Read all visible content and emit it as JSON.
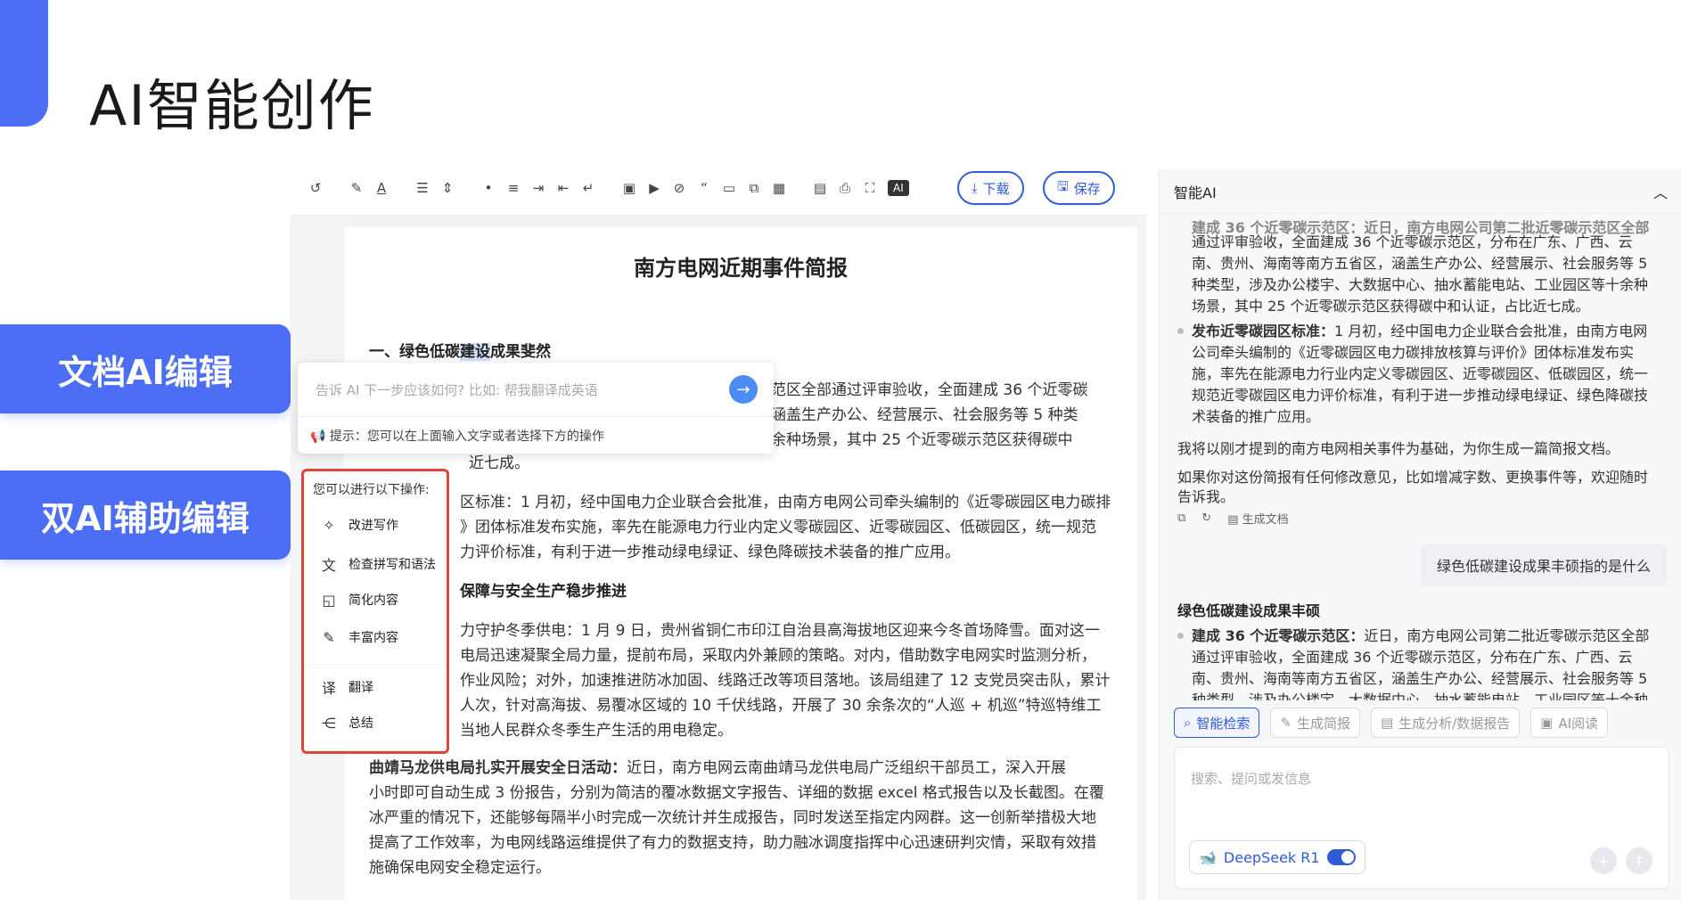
{
  "slide": {
    "title": "AI智能创作",
    "side_buttons": [
      "文档AI编辑",
      "双AI辅助编辑"
    ]
  },
  "toolbar": {
    "ai_label": "AI",
    "download_label": "下载",
    "save_label": "保存"
  },
  "document": {
    "title": "南方电网近期事件简报",
    "section1_heading_a": "一、绿色低碳",
    "section1_heading_sel": "建设",
    "section1_heading_b": "成果斐然",
    "lines_right": [
      "示范区全部通过评审验收，全面建成 36 个近零碳",
      "，涵盖生产办公、经营展示、社会服务等 5 种类",
      "十余种场景，其中 25 个近零碳示范区获得碳中",
      "近七成。"
    ],
    "para2": [
      "区标准：1 月初，经中国电力企业联合会批准，由南方电网公司牵头编制的《近零碳园区电力碳排",
      "》团体标准发布实施，率先在能源电力行业内定义零碳园区、近零碳园区、低碳园区，统一规范",
      "力评价标准，有利于进一步推动绿电绿证、绿色降碳技术装备的推广应用。"
    ],
    "section2_heading": "保障与安全生产稳步推进",
    "para3": [
      "力守护冬季供电：1 月 9 日，贵州省铜仁市印江自治县高海拔地区迎来今冬首场降雪。面对这一",
      "电局迅速凝聚全局力量，提前布局，采取内外兼顾的策略。对内，借助数字电网实时监测分析，",
      "作业风险；对外，加速推进防冰加固、线路迁改等项目落地。该局组建了 12 支党员突击队，累计",
      "人次，针对高海拔、易覆冰区域的 10 千伏线路，开展了 30 余条次的“人巡 + 机巡”特巡特维工",
      "当地人民群众冬季生产生活的用电稳定。"
    ],
    "para4_bold": "曲靖马龙供电局扎实开展安全日活动：",
    "para4_first": "近日，南方电网云南曲靖马龙供电局广泛组织干部员工，深入开展",
    "para4": [
      "小时即可自动生成 3 份报告，分别为简洁的覆冰数据文字报告、详细的数据 excel 格式报告以及长截图。在覆",
      "冰严重的情况下，还能够每隔半小时完成一次统计并生成报告，同时发送至指定内网群。这一创新举措极大地",
      "提高了工作效率，为电网线路运维提供了有力的数据支持，助力融冰调度指挥中心迅速研判灾情，采取有效措",
      "施确保电网安全稳定运行。"
    ]
  },
  "ai_prompt": {
    "placeholder": "告诉 AI 下一步应该如何? 比如: 帮我翻译成英语",
    "hint": "提示：您可以在上面输入文字或者选择下方的操作"
  },
  "ops_menu": {
    "title": "您可以进行以下操作:",
    "items": [
      "改进写作",
      "检查拼写和语法",
      "简化内容",
      "丰富内容",
      "翻译",
      "总结"
    ]
  },
  "panel": {
    "title": "智能AI",
    "top_cut": "建成 36 个近零碳示范区：近日，南方电网公司第二批近零碳示范区全部",
    "block1": [
      "通过评审验收，全面建成 36 个近零碳示范区，分布在广东、广西、云",
      "南、贵州、海南等南方五省区，涵盖生产办公、经营展示、社会服务等 5",
      "种类型，涉及办公楼宇、大数据中心、抽水蓄能电站、工业园区等十余种",
      "场景，其中 25 个近零碳示范区获得碳中和认证，占比近七成。"
    ],
    "block2_bold": "发布近零碳园区标准：",
    "block2_first": "1 月初，经中国电力企业联合会批准，由南方电网",
    "block2": [
      "公司牵头编制的《近零碳园区电力碳排放核算与评价》团体标准发布实",
      "施，率先在能源电力行业内定义零碳园区、近零碳园区、低碳园区，统一",
      "规范近零碳园区电力评价标准，有利于进一步推动绿电绿证、绿色降碳技",
      "术装备的推广应用。"
    ],
    "msg1": "我将以刚才提到的南方电网相关事件为基础，为你生成一篇简报文档。",
    "msg2a": "如果你对这份简报有任何修改意见，比如增减字数、更换事件等，欢迎随时",
    "msg2b": "告诉我。",
    "gen_doc": "生成文档",
    "user_msg": "绿色低碳建设成果丰硕指的是什么",
    "answer_heading": "绿色低碳建设成果丰硕",
    "answer_bold": "建成 36 个近零碳示范区：",
    "answer_first": "近日，南方电网公司第二批近零碳示范区全部",
    "answer": [
      "通过评审验收，全面建成 36 个近零碳示范区，分布在广东、广西、云",
      "南、贵州、海南等南方五省区，涵盖生产办公、经营展示、社会服务等 5",
      "种类型，涉及办公楼宇、大数据中心、抽水蓄能电站、工业园区等十余种"
    ],
    "tabs": [
      "智能检索",
      "生成简报",
      "生成分析/数据报告",
      "AI阅读"
    ],
    "input_placeholder": "搜索、提问或发信息",
    "model": "DeepSeek R1"
  },
  "colors": {
    "accent": "#4b6ef5",
    "link_blue": "#2f5bd7",
    "highlight_red": "#e0443a"
  }
}
